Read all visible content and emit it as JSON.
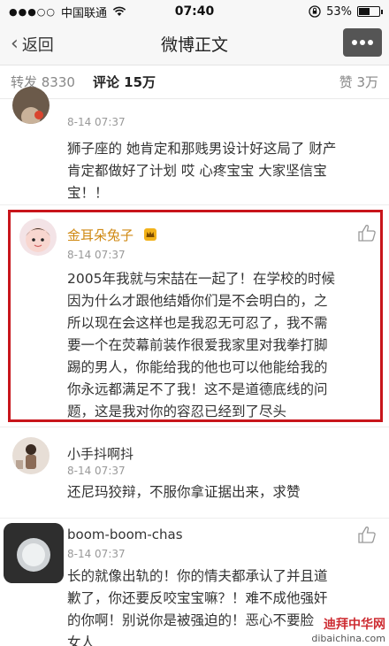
{
  "status_bar": {
    "signal": "●●●○○",
    "carrier": "中国联通",
    "time": "07:40",
    "battery": "53%",
    "battery_level": 0.53
  },
  "nav": {
    "back_label": "返回",
    "title": "微博正文"
  },
  "tabs": {
    "repost": "转发 8330",
    "comments": "评论 15万",
    "likes": "赞 3万"
  },
  "comments": [
    {
      "name": "",
      "time": "8-14 07:37",
      "lines": [
        "狮子座的 她肯定和那贱男设计好这局了 财产",
        "肯定都做好了计划 哎 心疼宝宝 大家坚信宝",
        "宝！！"
      ]
    },
    {
      "name": "金耳朵兔子",
      "time": "8-14 07:37",
      "lines": [
        "2005年我就与宋喆在一起了！在学校的时候",
        "因为什么才跟他结婚你们是不会明白的，之",
        "所以现在会这样也是我忍无可忍了，我不需",
        "要一个在荧幕前装作很爱我家里对我拳打脚",
        "踢的男人，你能给我的他也可以他能给我的",
        "你永远都满足不了我！这不是道德底线的问",
        "题，这是我对你的容忍已经到了尽头"
      ]
    },
    {
      "name": "小手抖啊抖",
      "time": "8-14 07:37",
      "lines": [
        "还尼玛狡辩，不服你拿证据出来，求赞"
      ]
    },
    {
      "name": "boom-boom-chas",
      "time": "8-14 07:37",
      "lines": [
        "长的就像出轨的！你的情夫都承认了并且道",
        "歉了，你还要反咬宝宝嘛？！难不成他强奸",
        "的你啊！别说你是被强迫的！恶心不要脸",
        "女人"
      ]
    }
  ],
  "watermark": {
    "main": "迪拜中华网",
    "url": "dibaichina.com"
  },
  "colors": {
    "highlight": "#c8151b",
    "gold_name": "#d08a14"
  }
}
